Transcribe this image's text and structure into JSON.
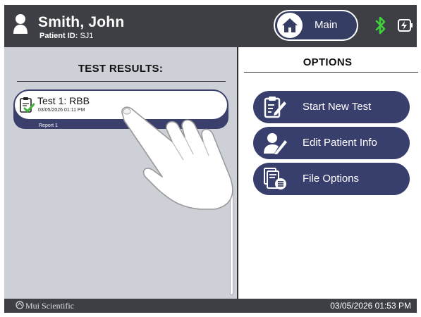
{
  "header": {
    "patient_name": "Smith, John",
    "patient_id_label": "Patient ID:",
    "patient_id": "SJ1",
    "main_button_label": "Main",
    "bluetooth_color": "#3fd13a"
  },
  "left_panel": {
    "title": "TEST RESULTS:",
    "results": [
      {
        "title": "Test 1: RBB",
        "date": "03/05/2026 01:11 PM",
        "report": "Report 1"
      }
    ]
  },
  "right_panel": {
    "title": "OPTIONS",
    "buttons": [
      {
        "label": "Start New Test",
        "icon": "clipboard-edit-icon"
      },
      {
        "label": "Edit Patient Info",
        "icon": "user-edit-icon"
      },
      {
        "label": "File Options",
        "icon": "file-list-icon"
      }
    ]
  },
  "footer": {
    "brand": "Mui Scientific",
    "datetime": "03/05/2026 01:53 PM"
  },
  "colors": {
    "header_bg": "#3d3f45",
    "accent_navy": "#393f6c",
    "left_panel_bg": "#cdd0d6"
  }
}
